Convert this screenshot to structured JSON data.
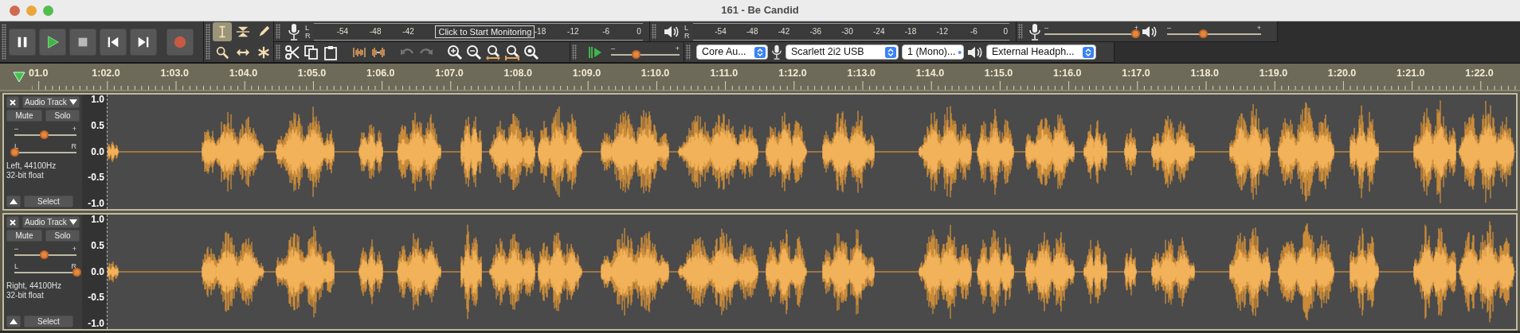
{
  "window": {
    "title": "161 - Be Candid"
  },
  "transport": [
    {
      "kind": "pause"
    },
    {
      "kind": "play"
    },
    {
      "kind": "stop"
    },
    {
      "kind": "skip-start"
    },
    {
      "kind": "skip-end"
    },
    {
      "kind": "record"
    }
  ],
  "tools": [
    {
      "kind": "select",
      "selected": true
    },
    {
      "kind": "envelope",
      "selected": false
    },
    {
      "kind": "draw",
      "selected": false
    },
    {
      "kind": "zoom",
      "selected": false
    },
    {
      "kind": "time-shift",
      "selected": false
    },
    {
      "kind": "multi",
      "selected": false
    }
  ],
  "record_meter": {
    "channels": [
      "L",
      "R"
    ],
    "ticks": [
      "-54",
      "-48",
      "-42",
      "-18",
      "-12",
      "-6",
      "0"
    ],
    "prompt": "Click to Start Monitoring"
  },
  "playback_meter": {
    "channels": [
      "L",
      "R"
    ],
    "ticks": [
      "-54",
      "-48",
      "-42",
      "-36",
      "-30",
      "-24",
      "-18",
      "-12",
      "-6",
      "0"
    ]
  },
  "mixer": {
    "record_volume": {
      "minus": "–",
      "plus": "+",
      "level": 0.97
    },
    "playback_volume": {
      "minus": "–",
      "plus": "+",
      "level": 0.38
    }
  },
  "edit_tools": [
    {
      "kind": "cut",
      "disabled": false
    },
    {
      "kind": "copy",
      "disabled": false
    },
    {
      "kind": "paste",
      "disabled": false
    },
    {
      "kind": "trim",
      "disabled": false
    },
    {
      "kind": "silence",
      "disabled": false
    },
    {
      "kind": "undo",
      "disabled": true
    },
    {
      "kind": "redo",
      "disabled": true
    },
    {
      "kind": "zoom-in",
      "disabled": false
    },
    {
      "kind": "zoom-out",
      "disabled": false
    },
    {
      "kind": "fit-selection",
      "disabled": false
    },
    {
      "kind": "fit-project",
      "disabled": false
    },
    {
      "kind": "zoom-toggle",
      "disabled": false
    }
  ],
  "play_at_speed": {
    "minus": "–",
    "plus": "+",
    "level": 0.36
  },
  "devices": [
    {
      "kind": "host",
      "value": "Core Au..."
    },
    {
      "kind": "input",
      "value": "Scarlett 2i2 USB"
    },
    {
      "kind": "channels",
      "value": "1 (Mono)..."
    },
    {
      "kind": "output",
      "value": "External Headph..."
    }
  ],
  "ruler": {
    "labels": [
      "01.0",
      "1:02.0",
      "1:03.0",
      "1:04.0",
      "1:05.0",
      "1:06.0",
      "1:07.0",
      "1:08.0",
      "1:09.0",
      "1:10.0",
      "1:11.0",
      "1:12.0",
      "1:13.0",
      "1:14.0",
      "1:15.0",
      "1:16.0",
      "1:17.0",
      "1:18.0",
      "1:19.0",
      "1:20.0",
      "1:21.0",
      "1:22.0"
    ]
  },
  "tracks": [
    {
      "name": "Audio Track",
      "mute": "Mute",
      "solo": "Solo",
      "gain": {
        "minus": "–",
        "plus": "+",
        "level": 0.47
      },
      "pan": {
        "left": "L",
        "right": "R",
        "level": 0
      },
      "info": [
        "Left, 44100Hz",
        "32-bit float"
      ],
      "select": "Select",
      "scale": [
        "1.0",
        "0.5",
        "0.0",
        "-0.5",
        "-1.0"
      ]
    },
    {
      "name": "Audio Track",
      "mute": "Mute",
      "solo": "Solo",
      "gain": {
        "minus": "–",
        "plus": "+",
        "level": 0.47
      },
      "pan": {
        "left": "L",
        "right": "R",
        "level": 1
      },
      "info": [
        "Right, 44100Hz",
        "32-bit float"
      ],
      "select": "Select",
      "scale": [
        "1.0",
        "0.5",
        "0.0",
        "-0.5",
        "-1.0"
      ]
    }
  ]
}
